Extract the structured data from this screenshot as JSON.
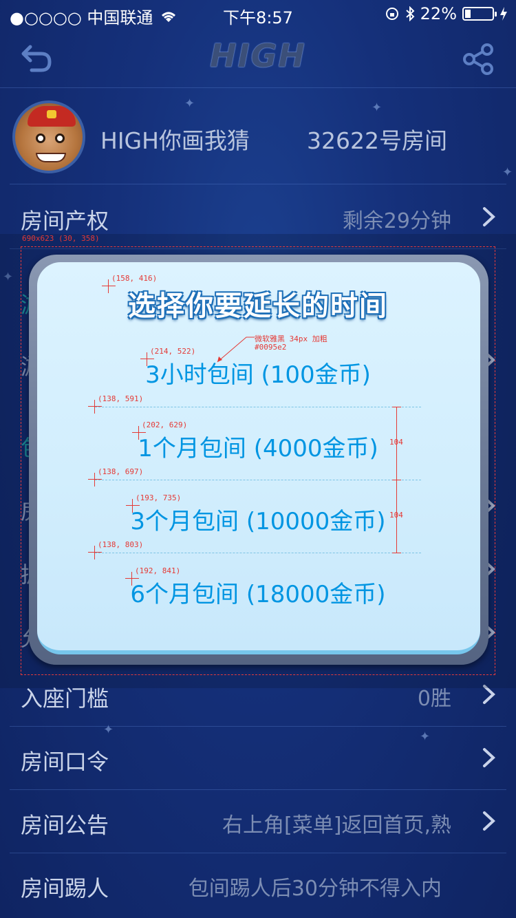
{
  "status_bar": {
    "carrier": "●○○○○ 中国联通",
    "time": "下午8:57",
    "battery": "22%",
    "battery_level": 0.22
  },
  "nav": {
    "title": "HIGH",
    "back_icon": "back-arrow-icon",
    "share_icon": "share-icon"
  },
  "room": {
    "name": "HIGH你画我猜",
    "number": "32622号房间"
  },
  "rows": {
    "ownership": {
      "label": "房间产权",
      "value": "剩余29分钟"
    },
    "partial_1": "游",
    "partial_2": "游",
    "partial_3": "包",
    "partial_4": "房",
    "partial_5": "拥",
    "partial_6": "允",
    "threshold": {
      "label": "入座门槛",
      "value": "0胜"
    },
    "password": {
      "label": "房间口令",
      "value": ""
    },
    "notice": {
      "label": "房间公告",
      "value": "右上角[菜单]返回首页,熟"
    },
    "kick": {
      "label": "房间踢人",
      "value": "包间踢人后30分钟不得入内"
    }
  },
  "modal": {
    "title": "选择你要延长的时间",
    "options": [
      "3小时包间 (100金币)",
      "1个月包间 (4000金币)",
      "3个月包间 (10000金币)",
      "6个月包间 (18000金币)"
    ]
  },
  "annotations": {
    "frame": "690x623 (30, 358)",
    "title_pos": "(158, 416)",
    "opt1_pos": "(214, 522)",
    "font_note_1": "微软雅黑 34px 加粗",
    "font_note_2": "#0095e2",
    "sep1_pos": "(138, 591)",
    "opt2_pos": "(202, 629)",
    "sep2_pos": "(138, 697)",
    "opt3_pos": "(193, 735)",
    "sep3_pos": "(138, 803)",
    "opt4_pos": "(192, 841)",
    "gap_1": "104",
    "gap_2": "104"
  }
}
